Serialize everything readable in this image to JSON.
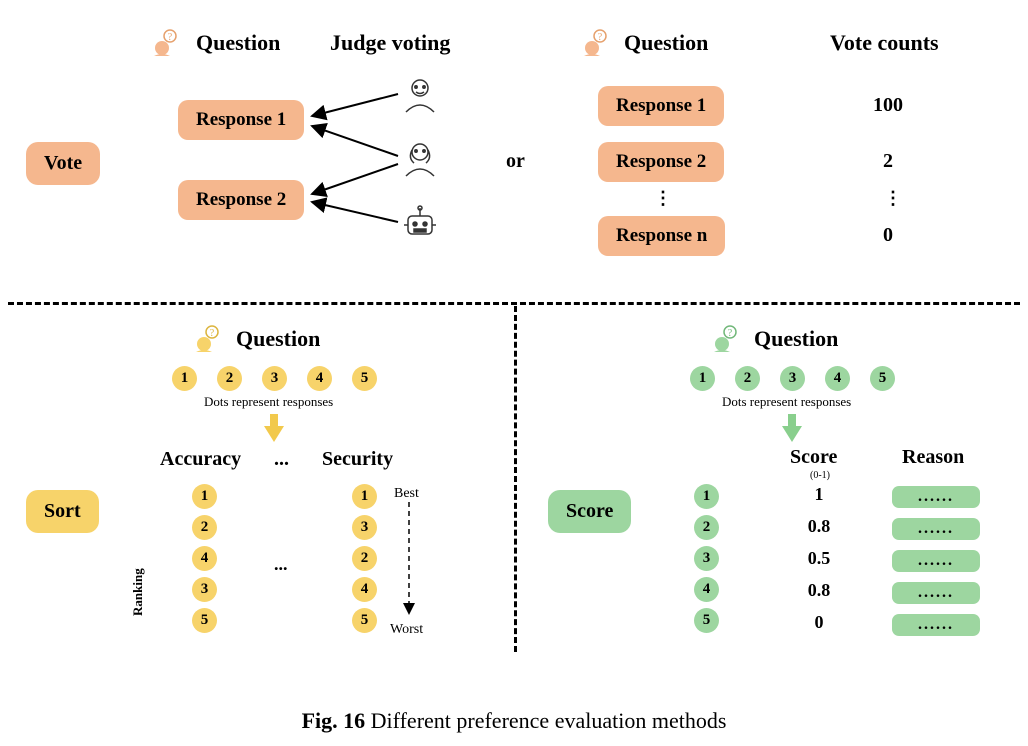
{
  "caption": {
    "label": "Fig. 16",
    "text": "Different preference evaluation methods"
  },
  "methods": {
    "vote": "Vote",
    "sort": "Sort",
    "score": "Score"
  },
  "headings": {
    "question": "Question",
    "judge_voting": "Judge voting",
    "vote_counts": "Vote counts",
    "accuracy": "Accuracy",
    "security": "Security",
    "score": "Score",
    "score_range": "(0-1)",
    "reason": "Reason",
    "or": "or"
  },
  "vote": {
    "left": {
      "responses": [
        "Response 1",
        "Response 2"
      ]
    },
    "right": {
      "responses": [
        "Response 1",
        "Response 2",
        "Response n"
      ],
      "counts": [
        "100",
        "2",
        "0"
      ]
    }
  },
  "notes": {
    "dots_represent": "Dots represent responses",
    "ranking": "Ranking",
    "best": "Best",
    "worst": "Worst",
    "ellipsis": "...",
    "dots6": "......"
  },
  "sort": {
    "items": [
      "1",
      "2",
      "3",
      "4",
      "5"
    ],
    "accuracy_rank": [
      "1",
      "2",
      "4",
      "3",
      "5"
    ],
    "security_rank": [
      "1",
      "3",
      "2",
      "4",
      "5"
    ]
  },
  "score": {
    "items": [
      "1",
      "2",
      "3",
      "4",
      "5"
    ],
    "values": [
      "1",
      "0.8",
      "0.5",
      "0.8",
      "0"
    ]
  }
}
